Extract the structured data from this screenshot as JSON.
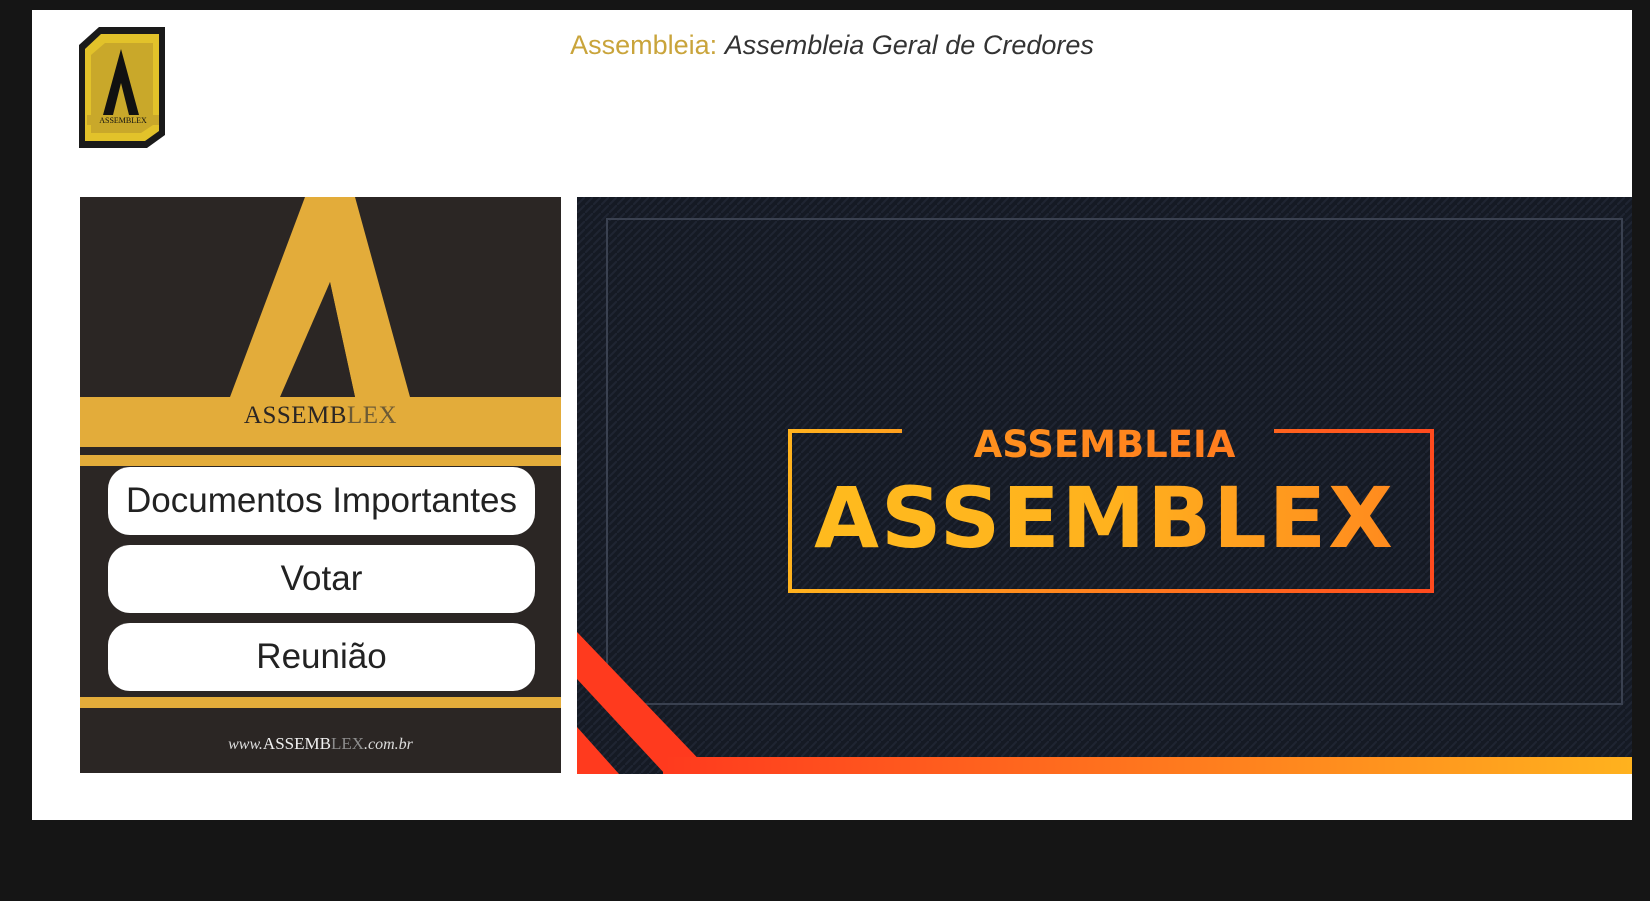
{
  "header": {
    "title_label": "Assembleia:",
    "title_value": "Assembleia Geral de Credores",
    "logo_text": "ASSEMBLEX"
  },
  "sidebar": {
    "brand_strong": "ASSEMB",
    "brand_light": "LEX",
    "menu": [
      {
        "label": "Documentos Importantes"
      },
      {
        "label": "Votar"
      },
      {
        "label": "Reunião"
      }
    ],
    "footer_prefix": "www.",
    "footer_strong": "ASSEMB",
    "footer_light": "LEX",
    "footer_suffix": ".com.br"
  },
  "banner": {
    "top_text": "ASSEMBLEIA",
    "main_text": "ASSEMBLEX"
  },
  "colors": {
    "gold": "#e3ac3a",
    "dark": "#2b2624",
    "banner_bg": "#141821",
    "accent_orange": "#ff5c1e"
  }
}
